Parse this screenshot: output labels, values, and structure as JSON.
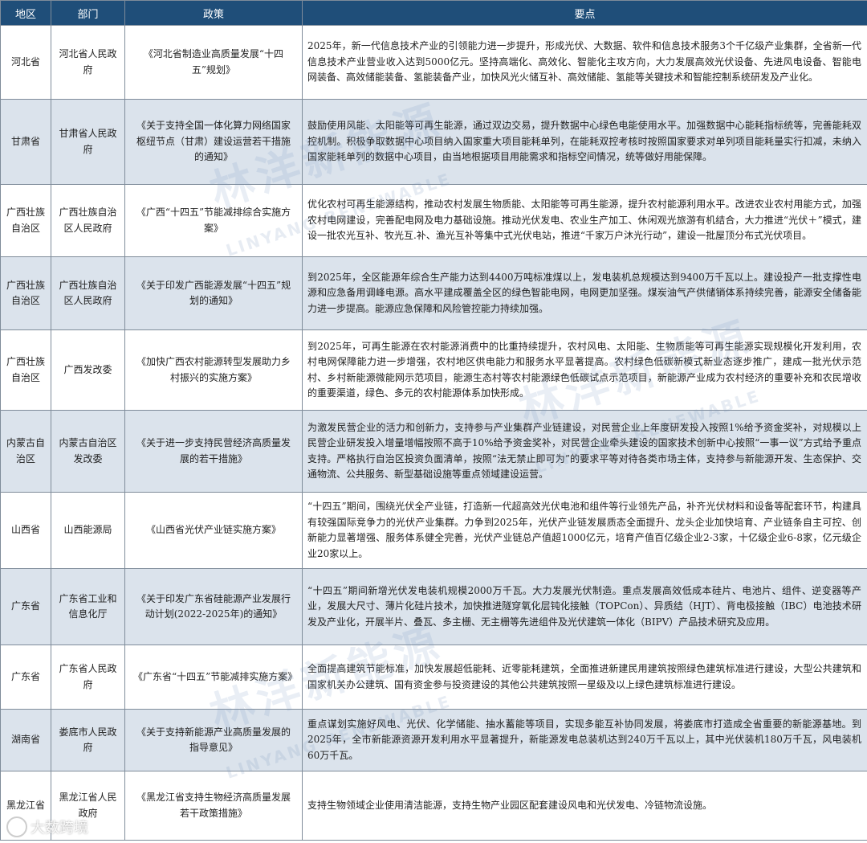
{
  "headers": {
    "region": "地区",
    "department": "部门",
    "policy": "政策",
    "points": "要点"
  },
  "rows": [
    {
      "region": "河北省",
      "department": "河北省人民政府",
      "policy": "《河北省制造业高质量发展“十四五”规划》",
      "points": "2025年，新一代信息技术产业的引领能力进一步提升，形成光伏、大数据、软件和信息技术服务3个千亿级产业集群，全省新一代信息技术产业营业收入达到5000亿元。坚持高端化、高效化、智能化主攻方向，大力发展高效光伏设备、先进风电设备、智能电网装备、高效储能装备、氢能装备产业，加快风光火储互补、高效储能、氢能等关键技术和智能控制系统研发及产业化。"
    },
    {
      "region": "甘肃省",
      "department": "甘肃省人民政府",
      "policy": "《关于支持全国一体化算力网络国家枢纽节点（甘肃）建设运营若干措施的通知》",
      "points": "鼓励使用风能、太阳能等可再生能源，通过双边交易，提升数据中心绿色电能使用水平。加强数据中心能耗指标统等，完善能耗双控机制。积极争取数据中心项目纳入国家重大项目能耗单列，在能耗双控考核时按照国家要求对单列项目能耗量实行扣减，未纳入国家能耗单列的数据中心项目，由当地根据项目用能需求和指标空间情况，统等做好用能保障。"
    },
    {
      "region": "广西壮族自治区",
      "department": "广西壮族自治区人民政府",
      "policy": "《广西“十四五”节能减排综合实施方案》",
      "points": "优化农村可再生能源结构，推动农村发展生物质能、太阳能等可再生能源，提升农村能源利用水平。改进农业农村用能方式，加强农村电网建设，完善配电网及电力基础设施。推动光伏发电、农业生产加工、休闲观光旅游有机结合，大力推进“光伏＋”模式，建设一批农光互补、牧光互.补、渔光互补等集中式光伏电站，推进“千家万户沐光行动”，建设一批屋顶分布式光伏项目。"
    },
    {
      "region": "广西壮族自治区",
      "department": "广西壮族自治区人民政府",
      "policy": "《关于印发广西能源发展“十四五”规划的通知》",
      "points": "到2025年，全区能源年综合生产能力达到4400万吨标准煤以上，发电装机总规模达到9400万千瓦以上。建设投产一批支撑性电源和应急备用调峰电源。高水平建成覆盖全区的绿色智能电网，电网更加坚强。煤炭油气产供储销体系持续完善，能源安全储备能力进一步提高。能源应急保障和风险管控能力持续加强。"
    },
    {
      "region": "广西壮族自治区",
      "department": "广西发改委",
      "policy": "《加快广西农村能源转型发展助力乡村振兴的实施方案》",
      "points": "到2025年，可再生能源在农村能源消费中的比重持续提升，农村风电、太阳能、生物质能等可再生能源实现规模化开发利用，农村电网保障能力进一步增强，农村地区供电能力和服务水平显著提高。农村绿色低碳新模式新业态逐步推广，建成一批光伏示范村、乡村新能源微能网示范项目，能源生态村等农村能源绿色低碳试点示范项目，新能源产业成为农村经济的重要补充和农民增收的重要渠道，绿色、多元的农村能源体系加快形成。"
    },
    {
      "region": "内蒙古自治区",
      "department": "内蒙古自治区发改委",
      "policy": "《关于进一步支持民营经济高质量发展的若干措施》",
      "points": "为激发民营企业的活力和创新力，支持参与产业集群产业链建设，对民营企业上年度研发投入按照1%给予资金奖补，对规模以上民营企业研发投入增量增幅按照不高于10%给予资金奖补，对民营企业牵头建设的国家技术创新中心按照“一事一议”方式给予重点支持。严格执行自治区投资负面清单，按照“法无禁止即可为”的要求平等对待各类市场主体，支持参与新能源开发、生态保护、交通物流、公共服务、新型基础设施等重点领域建设运营。"
    },
    {
      "region": "山西省",
      "department": "山西能源局",
      "policy": "《山西省光伏产业链实施方案》",
      "points": "“十四五”期间，围绕光伏全产业链，打造新一代超高效光伏电池和组件等行业领先产品，补齐光伏材料和设备等配套环节，构建具有较强国际竞争力的光伏产业集群。力争到2025年，光伏产业链发展质态全面提升、龙头企业加快培育、产业链条自主可控、创新能力显著增强、服务体系健全完善，光伏产业链总产值超1000亿元，培育产值百亿级企业2-3家，十亿级企业6-8家，亿元级企业20家以上。"
    },
    {
      "region": "广东省",
      "department": "广东省工业和信息化厅",
      "policy": "《关于印发广东省硅能源产业发展行动计划(2022-2025年)的通知》",
      "points": "“十四五”期间新增光伏发电装机规模2000万千瓦。大力发展光伏制造。重点发展高效低成本硅片、电池片、组件、逆变器等产业，发展大尺寸、薄片化硅片技术，加快推进隧穿氧化层钝化接触（TOPCon）、异质结（HJT）、背电极接触（IBC）电池技术研发及产业化，开展半片、叠瓦、多主栅、无主栅等先进组件及光伏建筑一体化（BIPV）产品技术研究及应用。"
    },
    {
      "region": "广东省",
      "department": "广东省人民政府",
      "policy": "《广东省“十四五”节能减排实施方案》",
      "points": "全面提高建筑节能标准，加快发展超低能耗、近零能耗建筑，全面推进新建民用建筑按照绿色建筑标准进行建设，大型公共建筑和国家机关办公建筑、国有资金参与投资建设的其他公共建筑按照一星级及以上绿色建筑标准进行建设。"
    },
    {
      "region": "湖南省",
      "department": "娄底市人民政府",
      "policy": "《关于支持新能源产业高质量发展的指导意见》",
      "points": "重点谋划实施好风电、光伏、化学储能、抽水蓄能等项目，实现多能互补协同发展，将娄底市打造成全省重要的新能源基地。到2025年，全市新能源资源开发利用水平显著提升，新能源发电总装机达到240万千瓦以上，其中光伏装机180万千瓦，风电装机60万千瓦。"
    },
    {
      "region": "黑龙江省",
      "department": "黑龙江省人民政府",
      "policy": "《黑龙江省支持生物经济高质量发展若干政策措施》",
      "points": "支持生物领域企业使用清洁能源，支持生物产业园区配套建设风电和光伏发电、冷链物流设施。"
    }
  ],
  "watermark": {
    "cn": "林洋新能源",
    "en": "LINYANG RENEWABLE"
  },
  "footer": {
    "logo_text": "大数跨境"
  }
}
